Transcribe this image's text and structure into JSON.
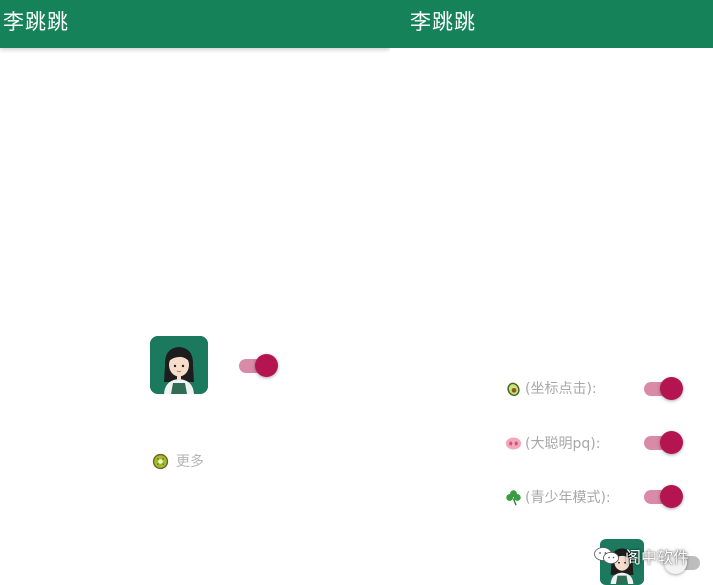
{
  "left_screen": {
    "title": "李跳跳",
    "toggle_on": true,
    "more_label": "更多",
    "more_emoji": "kiwi-icon"
  },
  "right_screen": {
    "title": "李跳跳",
    "rows": [
      {
        "emoji": "avocado-icon",
        "label": "(坐标点击):",
        "on": true
      },
      {
        "emoji": "pig-nose-icon",
        "label": "(大聪明pq):",
        "on": true
      },
      {
        "emoji": "shamrock-icon",
        "label": "(青少年模式):",
        "on": true
      }
    ],
    "bottom_toggle_on": false
  },
  "watermark": {
    "text": "阁中软件",
    "icon": "wechat-icon"
  },
  "colors": {
    "appbar": "#16825a",
    "toggle_thumb": "#b4144f",
    "toggle_track": "#d98aa6",
    "label_text": "#a8a8a8"
  }
}
